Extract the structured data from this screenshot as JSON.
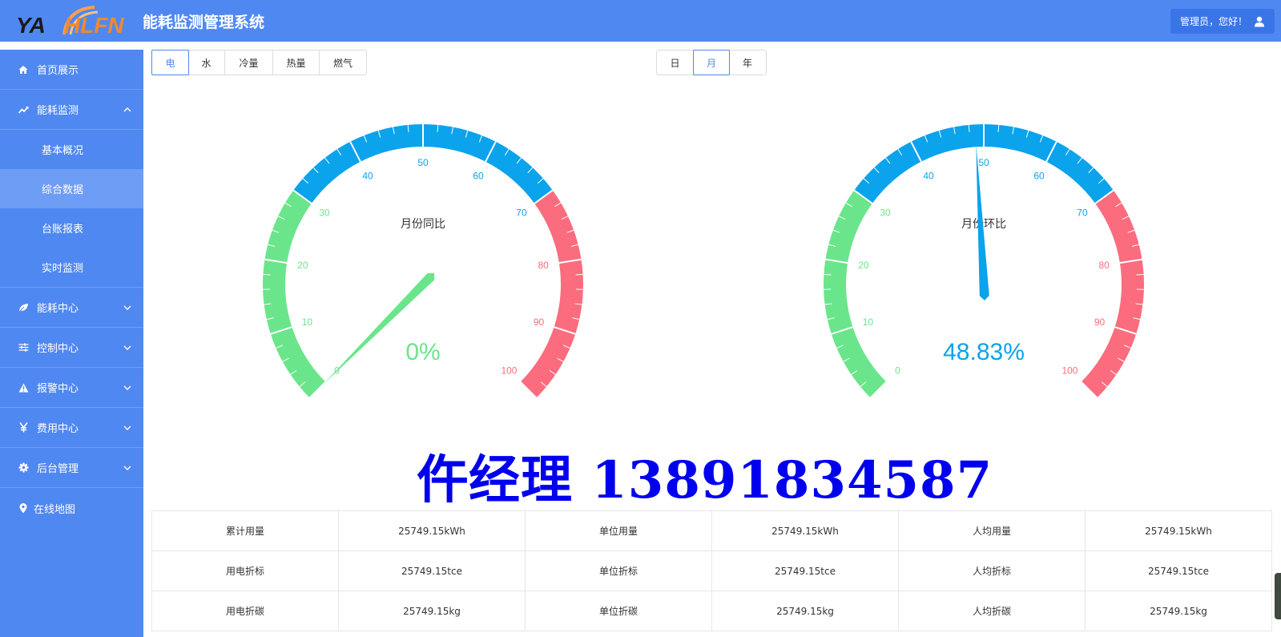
{
  "header": {
    "logo_text": "YAHLFN",
    "title": "能耗监测管理系统",
    "user_greeting": "管理员，您好！",
    "user_icon": "user-icon"
  },
  "sidebar": {
    "items": [
      {
        "label": "首页展示",
        "icon": "home-icon"
      },
      {
        "label": "能耗监测",
        "icon": "trend-icon",
        "expanded": true,
        "children": [
          {
            "label": "基本概况"
          },
          {
            "label": "综合数据",
            "active": true
          },
          {
            "label": "台账报表"
          },
          {
            "label": "实时监测"
          }
        ]
      },
      {
        "label": "能耗中心",
        "icon": "leaf-icon"
      },
      {
        "label": "控制中心",
        "icon": "sliders-icon"
      },
      {
        "label": "报警中心",
        "icon": "warning-icon"
      },
      {
        "label": "费用中心",
        "icon": "yen-icon"
      },
      {
        "label": "后台管理",
        "icon": "gear-icon"
      },
      {
        "label": "在线地图",
        "icon": "map-pin-icon"
      }
    ]
  },
  "energy_tabs": [
    "电",
    "水",
    "冷量",
    "热量",
    "燃气"
  ],
  "energy_tab_selected": "电",
  "period_tabs": [
    "日",
    "月",
    "年"
  ],
  "period_tab_selected": "月",
  "gauges": [
    {
      "title": "月份同比",
      "value": 0,
      "value_label": "0%",
      "value_color": "#6be58b"
    },
    {
      "title": "月份环比",
      "value": 48.83,
      "value_label": "48.83%",
      "value_color": "#0aa3ec"
    }
  ],
  "gauge_scale": {
    "min": 0,
    "max": 100,
    "ticks": [
      "0",
      "10",
      "20",
      "30",
      "40",
      "50",
      "60",
      "70",
      "80",
      "90",
      "100"
    ],
    "bands": [
      {
        "to": 30,
        "color": "#6be58b"
      },
      {
        "to": 70,
        "color": "#0aa3ec"
      },
      {
        "to": 100,
        "color": "#fa6c7e"
      }
    ]
  },
  "watermark": "仵经理  13891834587",
  "stats": {
    "rows": [
      [
        "累计用量",
        "25749.15kWh",
        "单位用量",
        "25749.15kWh",
        "人均用量",
        "25749.15kWh"
      ],
      [
        "用电折标",
        "25749.15tce",
        "单位折标",
        "25749.15tce",
        "人均折标",
        "25749.15tce"
      ],
      [
        "用电折碳",
        "25749.15kg",
        "单位折碳",
        "25749.15kg",
        "人均折碳",
        "25749.15kg"
      ]
    ]
  }
}
